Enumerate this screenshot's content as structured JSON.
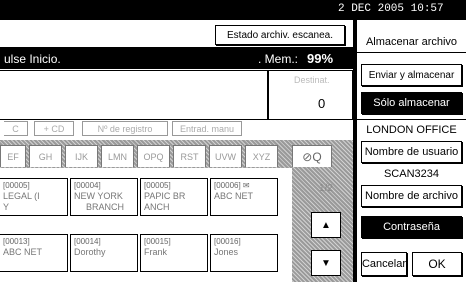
{
  "status": {
    "date": "2  DEC   2005 10:57"
  },
  "header": {
    "scan_status_button": "Estado archiv. escanea.",
    "instruction": "ulse Inicio.",
    "memory_label": ". Mem.:",
    "memory_value": "99%"
  },
  "dest_panel": {
    "label": "Destinat.",
    "count": "0"
  },
  "search_row": {
    "items": [
      "C",
      "+ CD",
      "Nº de registro",
      "Entrad. manu"
    ]
  },
  "tabs": [
    "EF",
    "GH",
    "IJK",
    "LMN",
    "OPQ",
    "RST",
    "UVW",
    "XYZ"
  ],
  "destinations": [
    {
      "code": "[00005]",
      "line1": "LEGAL (I",
      "line2": "Y"
    },
    {
      "code": "[00004]",
      "line1": "NEW YORK",
      "line2": "BRANCH"
    },
    {
      "code": "[00005]",
      "line1": "PAPIC BR",
      "line2": "ANCH"
    },
    {
      "code": "[00006] ✉",
      "line1": "ABC NET",
      "line2": ""
    },
    {
      "code": "[00013]",
      "line1": "ABC NET",
      "line2": ""
    },
    {
      "code": "[00014]",
      "line1": "Dorothy",
      "line2": ""
    },
    {
      "code": "[00015]",
      "line1": "Frank",
      "line2": ""
    },
    {
      "code": "[00016]",
      "line1": "Jones",
      "line2": ""
    }
  ],
  "pager": {
    "page": "1/2"
  },
  "right_panel": {
    "title": "Almacenar archivo",
    "send_store": "Enviar y almacenar",
    "store_only": "Sólo almacenar",
    "user_value": "LONDON OFFICE",
    "user_name_button": "Nombre de usuario",
    "file_value": "SCAN3234",
    "file_name_button": "Nombre de archivo",
    "password_button": "Contraseña",
    "cancel": "Cancelar",
    "ok": "OK"
  }
}
